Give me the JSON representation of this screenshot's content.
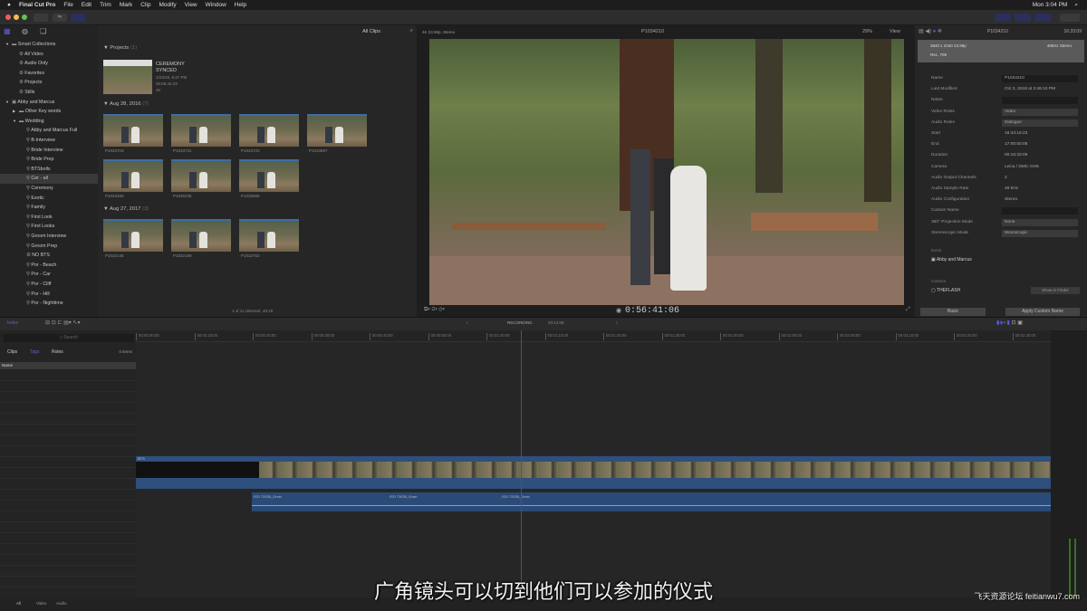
{
  "menubar": {
    "app": "Final Cut Pro",
    "items": [
      "File",
      "Edit",
      "Trim",
      "Mark",
      "Clip",
      "Modify",
      "View",
      "Window",
      "Help"
    ],
    "clock": "Mon 3:04 PM"
  },
  "sidebar": {
    "items": [
      {
        "label": "Smart Collections",
        "icon": "folder-icon",
        "indent": 1,
        "arrow": "▼"
      },
      {
        "label": "All Video",
        "icon": "smart-collection-icon",
        "indent": 2
      },
      {
        "label": "Audio Only",
        "icon": "smart-collection-icon",
        "indent": 2
      },
      {
        "label": "Favorites",
        "icon": "smart-collection-icon",
        "indent": 2
      },
      {
        "label": "Projects",
        "icon": "smart-collection-icon",
        "indent": 2
      },
      {
        "label": "Stills",
        "icon": "smart-collection-icon",
        "indent": 2
      },
      {
        "label": "Abby and Marcus",
        "icon": "event-icon",
        "indent": 1,
        "arrow": "▼"
      },
      {
        "label": "Other Key words",
        "icon": "folder-icon",
        "indent": 2,
        "arrow": "▶"
      },
      {
        "label": "Wedding",
        "icon": "folder-icon",
        "indent": 2,
        "arrow": "▼"
      },
      {
        "label": "Abby and Marcus Full",
        "icon": "keyword-icon",
        "indent": 3
      },
      {
        "label": "B-Interview",
        "icon": "keyword-icon",
        "indent": 3
      },
      {
        "label": "Bride Interview",
        "icon": "keyword-icon",
        "indent": 3
      },
      {
        "label": "Bride Prep",
        "icon": "keyword-icon",
        "indent": 3
      },
      {
        "label": "BTSbolls",
        "icon": "keyword-icon",
        "indent": 3
      },
      {
        "label": "Cer - all",
        "icon": "keyword-icon",
        "indent": 3,
        "selected": true
      },
      {
        "label": "Ceremony",
        "icon": "keyword-icon",
        "indent": 3
      },
      {
        "label": "Exotic",
        "icon": "keyword-icon",
        "indent": 3
      },
      {
        "label": "Family",
        "icon": "keyword-icon",
        "indent": 3
      },
      {
        "label": "First Look",
        "icon": "keyword-icon",
        "indent": 3
      },
      {
        "label": "First Looks",
        "icon": "keyword-icon",
        "indent": 3
      },
      {
        "label": "Groom Interview",
        "icon": "keyword-icon",
        "indent": 3
      },
      {
        "label": "Groom Prep",
        "icon": "keyword-icon",
        "indent": 3
      },
      {
        "label": "NO BTS",
        "icon": "smart-collection-icon",
        "indent": 3
      },
      {
        "label": "Por - Beach",
        "icon": "keyword-icon",
        "indent": 3
      },
      {
        "label": "Por - Car",
        "icon": "keyword-icon",
        "indent": 3
      },
      {
        "label": "Por - Cliff",
        "icon": "keyword-icon",
        "indent": 3
      },
      {
        "label": "Por - Hill",
        "icon": "keyword-icon",
        "indent": 3
      },
      {
        "label": "Por - Nighttime",
        "icon": "keyword-icon",
        "indent": 3
      }
    ]
  },
  "browser": {
    "filter": "All Clips",
    "projects_header": "Projects",
    "projects_count": "(1)",
    "project": {
      "name1": "CEREMONY",
      "name2": "SYNCED",
      "date": "1/23/18, 8:47 PM",
      "duration": "00:06:44;23",
      "extra": "4K"
    },
    "groups": [
      {
        "date": "Aug 28, 2016",
        "count": "(7)",
        "clips": [
          "P1033719",
          "P1033722",
          "P1033723",
          "P1033887",
          "P1034469",
          "P1035235",
          "P1035669"
        ]
      },
      {
        "date": "Aug 27, 2017",
        "count": "(3)",
        "clips": [
          "P1032148",
          "P1032169",
          "P1032763"
        ]
      }
    ],
    "status": "1 of 11 selected, 40:19"
  },
  "viewer": {
    "clip_info": "4K 23.98p, Stereo",
    "title": "P1034210",
    "zoom": "29%",
    "view": "View",
    "timecode": "0:56:41:06"
  },
  "inspector": {
    "title": "P1034210",
    "duration": "16:33:09",
    "summary1": "3840 x 2160 23.98p",
    "summary2": "48kHz Stereo",
    "summary3": "Rec. 709",
    "rows": [
      {
        "label": "Name",
        "value": "P1034210",
        "style": "box"
      },
      {
        "label": "Last Modified",
        "value": "Oct 3, 2018 at 3:46:10 PM",
        "style": "text"
      },
      {
        "label": "Notes",
        "value": "",
        "style": "box"
      },
      {
        "label": "Video Roles",
        "value": "Video",
        "style": "pop"
      },
      {
        "label": "Audio Roles",
        "value": "Dialogue",
        "style": "pop"
      },
      {
        "label": "Start",
        "value": "16:43:16:23",
        "style": "text"
      },
      {
        "label": "End",
        "value": "17:00:50:08",
        "style": "text"
      },
      {
        "label": "Duration",
        "value": "00:16:33:09",
        "style": "text"
      },
      {
        "label": "Camera",
        "value": "Leica / DMC-GH5",
        "style": "text"
      },
      {
        "label": "Audio Output Channels",
        "value": "2",
        "style": "text"
      },
      {
        "label": "Audio Sample Rate",
        "value": "48 kHz",
        "style": "text"
      },
      {
        "label": "Audio Configuration",
        "value": "Stereo",
        "style": "text"
      },
      {
        "label": "Custom Name",
        "value": "",
        "style": "box"
      },
      {
        "label": "360° Projection Mode",
        "value": "None",
        "style": "pop"
      },
      {
        "label": "Stereoscopic Mode",
        "value": "Monoscopic",
        "style": "pop"
      }
    ],
    "event_header": "Event",
    "event": "Abby and Marcus",
    "camera_header": "Camera",
    "camera": "THEFLASH",
    "show_finder": "Show in Finder",
    "basic": "Basic",
    "apply_names": "Apply Custom Name"
  },
  "timeline": {
    "index_tab": "Index",
    "search_placeholder": "Search",
    "tabs": [
      "Clips",
      "Tags",
      "Roles"
    ],
    "items_count": "0 items",
    "col_name": "Name",
    "project": "RECORDING",
    "duration": "33:14:08",
    "ruler": [
      "00:00:00:00",
      "00:00:10:00",
      "00:00:20:00",
      "00:00:30:00",
      "00:00:40:00",
      "00:00:50:00",
      "00:01:00:00",
      "00:01:10:00",
      "00:01:20:00",
      "00:01:30:00",
      "00:01:40:00",
      "00:01:50:00",
      "00:02:00:00",
      "00:02:10:00",
      "00:02:20:00",
      "00:02:30:00"
    ],
    "video_clip": "BTS",
    "audio_clips": [
      "ISO 72035_Drew",
      "ISO 73035_Evan",
      "ISO 72035_Drew"
    ],
    "bottom": [
      "All",
      "Video",
      "Audio"
    ]
  },
  "subtitle": "广角镜头可以切到他们可以参加的仪式",
  "watermark": "飞天资源论坛 feitianwu7.com",
  "colors": {
    "accent": "#5a5ee8",
    "clip": "#2f4f7c",
    "audio": "#2a4a78"
  }
}
